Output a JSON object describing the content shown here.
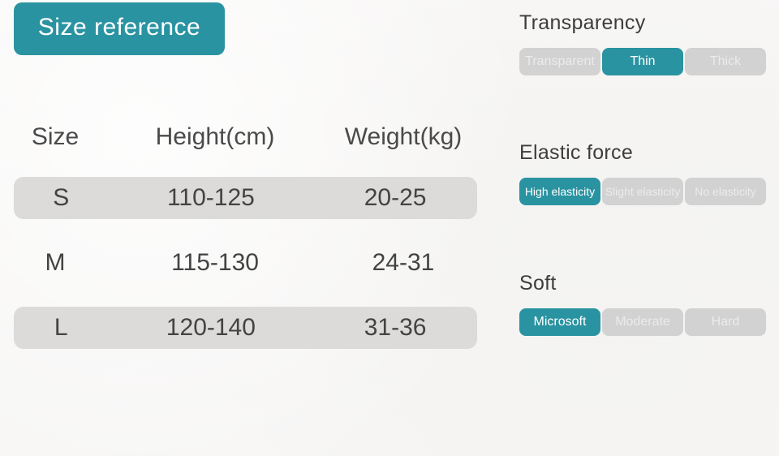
{
  "badge": {
    "label": "Size  reference"
  },
  "size_table": {
    "columns": [
      "Size",
      "Height(cm)",
      "Weight(kg)"
    ],
    "rows": [
      {
        "size": "S",
        "height": "110-125",
        "weight": "20-25",
        "striped": true
      },
      {
        "size": "M",
        "height": "115-130",
        "weight": "24-31",
        "striped": false
      },
      {
        "size": "L",
        "height": "120-140",
        "weight": "31-36",
        "striped": true
      }
    ]
  },
  "options": [
    {
      "title": "Transparency",
      "chips": [
        {
          "label": "Transparent",
          "selected": false
        },
        {
          "label": "Thin",
          "selected": true
        },
        {
          "label": "Thick",
          "selected": false
        }
      ]
    },
    {
      "title": "Elastic  force",
      "chips": [
        {
          "label": "High elasticity",
          "selected": true
        },
        {
          "label": "Slight  elasticity",
          "selected": false
        },
        {
          "label": "No  elasticity",
          "selected": false
        }
      ]
    },
    {
      "title": "Soft",
      "chips": [
        {
          "label": "Microsoft",
          "selected": true
        },
        {
          "label": "Moderate",
          "selected": false
        },
        {
          "label": "Hard",
          "selected": false
        }
      ]
    }
  ],
  "colors": {
    "accent": "#2a93a1",
    "chip_inactive_bg": "#d2d2d2",
    "chip_inactive_text": "#ebebeb",
    "row_stripe": "#dcdbd9",
    "page_bg": "#f7f6f4",
    "text": "#434343"
  }
}
